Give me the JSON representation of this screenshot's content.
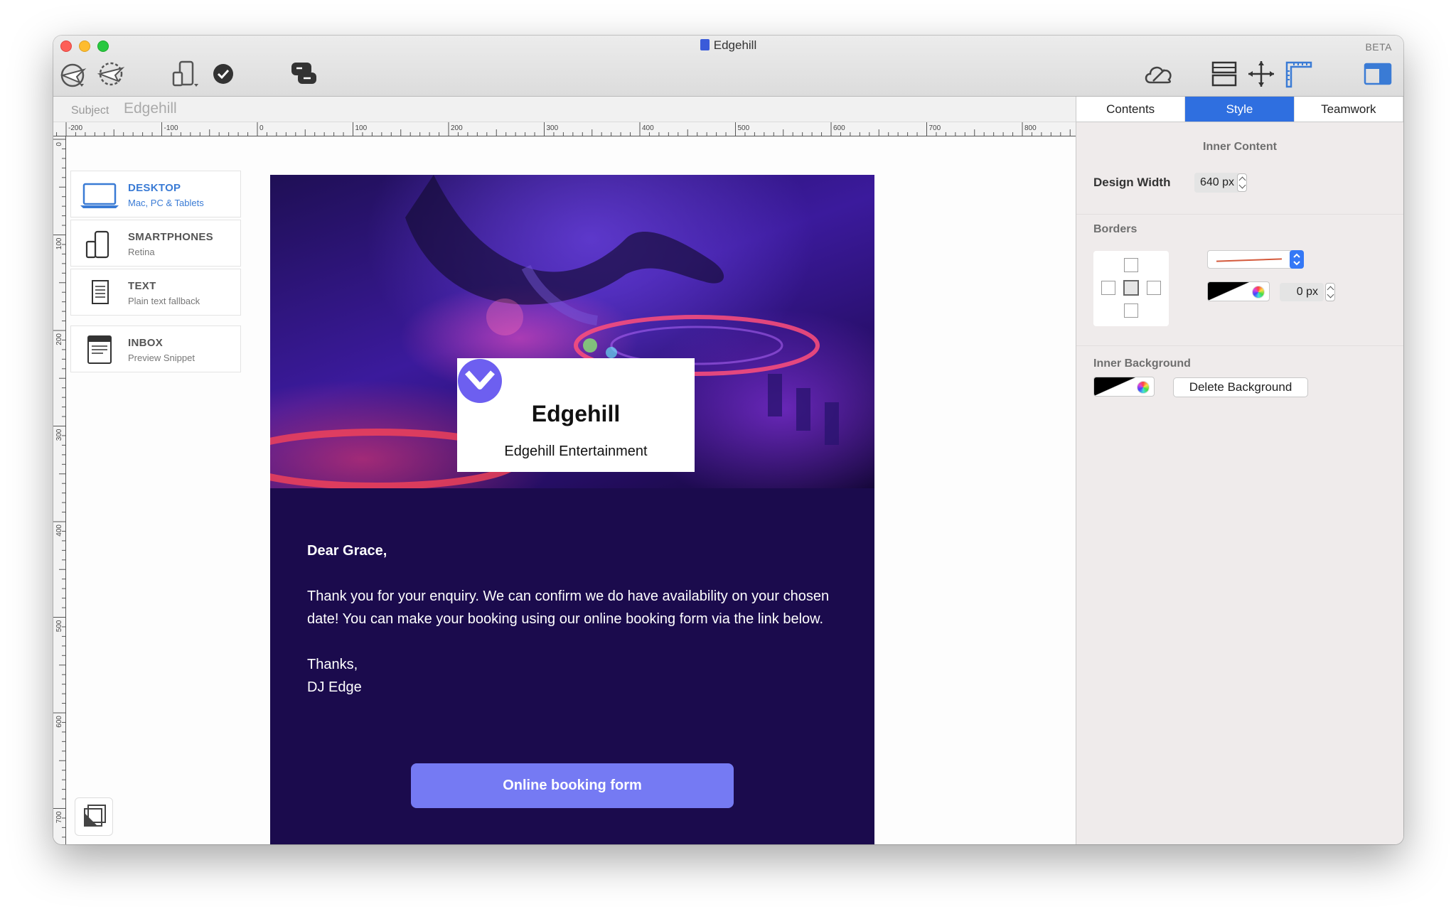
{
  "window": {
    "title": "Edgehill",
    "badge": "BETA"
  },
  "toolbar": {
    "icons": [
      "send-test-icon",
      "send-icon",
      "device-preview-icon",
      "check-icon",
      "feedback-icon",
      "cloud-icon",
      "layout-icon",
      "move-icon",
      "ruler-icon",
      "sidebar-toggle-icon"
    ]
  },
  "subject": {
    "label": "Subject",
    "value": "Edgehill"
  },
  "ruler": {
    "h_labels": [
      "-200",
      "-100",
      "0",
      "100",
      "200",
      "300",
      "400",
      "500",
      "600",
      "700",
      "800"
    ],
    "v_labels": [
      "0",
      "100",
      "200",
      "300",
      "400",
      "500",
      "600",
      "700"
    ]
  },
  "devices": [
    {
      "name": "DESKTOP",
      "sub": "Mac, PC & Tablets",
      "active": true
    },
    {
      "name": "SMARTPHONES",
      "sub": "Retina",
      "active": false
    },
    {
      "name": "TEXT",
      "sub": "Plain text fallback",
      "active": false
    },
    {
      "name": "INBOX",
      "sub": "Preview Snippet",
      "active": false
    }
  ],
  "email": {
    "logo_name": "Edgehill",
    "logo_sub": "Edgehill Entertainment",
    "greeting": "Dear Grace,",
    "paragraph": "Thank you for your enquiry. We can confirm we do have availability on your chosen date! You can make your booking using our online booking form via the link below.",
    "signoff_1": "Thanks,",
    "signoff_2": "DJ Edge",
    "cta_label": "Online booking form",
    "colors": {
      "background": "#1b0b4d",
      "cta": "#757af3",
      "logo_mark": "#6d5ff0"
    }
  },
  "panel": {
    "tabs": [
      "Contents",
      "Style",
      "Teamwork"
    ],
    "active_tab": "Style",
    "inner_content_title": "Inner Content",
    "design_width_label": "Design Width",
    "design_width_value": "640 px",
    "borders_title": "Borders",
    "border_width_value": "0 px",
    "inner_background_title": "Inner Background",
    "delete_background_label": "Delete Background",
    "accent": "#2f6fe0"
  }
}
